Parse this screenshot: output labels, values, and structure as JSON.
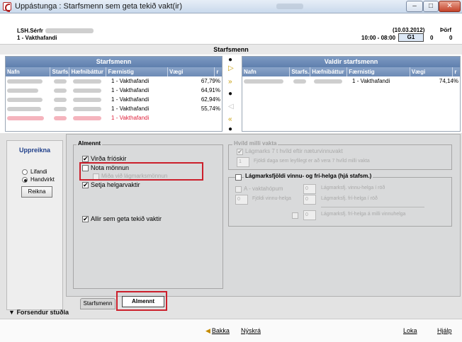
{
  "window": {
    "title": "Uppástunga : Starfsmenn sem geta tekið vakt(ir)",
    "min_label": "–",
    "max_label": "□",
    "close_label": "✕"
  },
  "header": {
    "name_prefix": "LSH.Sérfr",
    "shift": "1 - Vakthafandi",
    "date": "(10.03.2012)",
    "need_label": "Þörf",
    "time": "10:00 - 08:00",
    "shift_code": "G1",
    "need_value": "0",
    "count_value": "0"
  },
  "section_title": "Starfsmenn",
  "left_panel": {
    "title": "Starfsmenn",
    "columns": [
      "Nafn",
      "Starfs...",
      "Hæfnibáttur",
      "Færnistig",
      "Vægi",
      "r"
    ],
    "rows": [
      {
        "skill": "1 - Vakthafandi",
        "weight": "67,79%",
        "red": false
      },
      {
        "skill": "1 - Vakthafandi",
        "weight": "64,91%",
        "red": false
      },
      {
        "skill": "1 - Vakthafandi",
        "weight": "62,94%",
        "red": false
      },
      {
        "skill": "1 - Vakthafandi",
        "weight": "55,74%",
        "red": false
      },
      {
        "skill": "1 - Vakthafandi",
        "weight": "",
        "red": true
      }
    ]
  },
  "right_panel": {
    "title": "Valdir starfsmenn",
    "columns": [
      "Nafn",
      "Starfs...",
      "Hæfnibáttur",
      "Færnistig",
      "Vægi",
      "r"
    ],
    "rows": [
      {
        "skill": "1 - Vakthafandi",
        "weight": "74,14%"
      }
    ]
  },
  "uppreikna": {
    "title": "Uppreikna",
    "opt1": "Lifandi",
    "opt2": "Handvirkt",
    "button": "Reikna"
  },
  "almennt": {
    "title": "Almennt",
    "virda_frioskir": "Virða fríóskir",
    "nota_monnun": "Nota mönnun",
    "nota_sub": "Miða við lágmarksmönnun",
    "setja_helgarvaktir": "Setja helgarvaktir",
    "allir": "Allir sem geta tekið vaktir"
  },
  "hvild": {
    "title": "Hvíld milli vakta",
    "cb1": "Lágmarks 7 t hvíld eftir næturvinnuvakt",
    "spin1": "1",
    "spin1_label": "Fjöldi daga sem leyfilegt er að vera 7 hvíld milli vakta"
  },
  "lagmarks": {
    "title": "Lágmarksfjöldi vinnu- og frí-helga (hjá stafsm.)",
    "cb_a": "A - vaktahópum",
    "spin_a": "0",
    "label_a": "Lágmarksfj. vinnu-helga í röð",
    "spin_b": "0",
    "label_b": "Fjöldi vinnu-helga",
    "spin_c": "0",
    "label_c": "Lágmarksfj. frí-helga í röð",
    "spin_d": "0",
    "label_d": "Lágmarksfj. frí-helga á milli vinnuhelga"
  },
  "tabs": {
    "staff": "Starfsmenn",
    "almennt": "Almennt"
  },
  "forsendur": "Forsendur stuðla",
  "footer": {
    "back": "Bakka",
    "new": "Nýskrá",
    "close": "Loka",
    "help": "Hjálp"
  },
  "colors": {
    "accent": "#5f7fae",
    "red_highlight": "#cc1f2b",
    "inactive_row": "#e0213b"
  }
}
